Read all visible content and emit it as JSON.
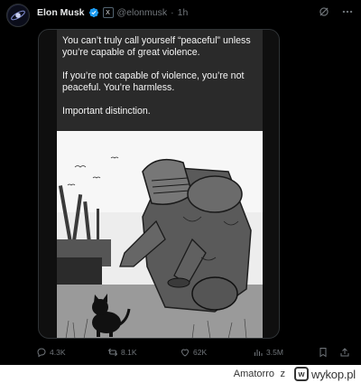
{
  "tweet": {
    "author_name": "Elon Musk",
    "affiliate_badge": "X",
    "handle": "@elonmusk",
    "separator": "·",
    "time": "1h"
  },
  "image_caption": {
    "paragraph_1": "You can’t truly call yourself “peaceful” unless you’re capable of great violence.",
    "paragraph_2": "If you’re not capable of violence, you’re not peaceful. You’re harmless.",
    "paragraph_3": "Important distinction."
  },
  "actions": {
    "replies": "4.3K",
    "reposts": "8.1K",
    "likes": "62K",
    "views": "3.5M"
  },
  "colors": {
    "background": "#000000",
    "text_primary": "#e7e9ea",
    "text_secondary": "#71767b",
    "verified_blue": "#1d9bf0",
    "caption_bg": "#2a2a2a"
  },
  "footer": {
    "username": "Amatorro",
    "z_label": "z",
    "logo_mark": "w",
    "logo_text": "wykop.pl"
  }
}
